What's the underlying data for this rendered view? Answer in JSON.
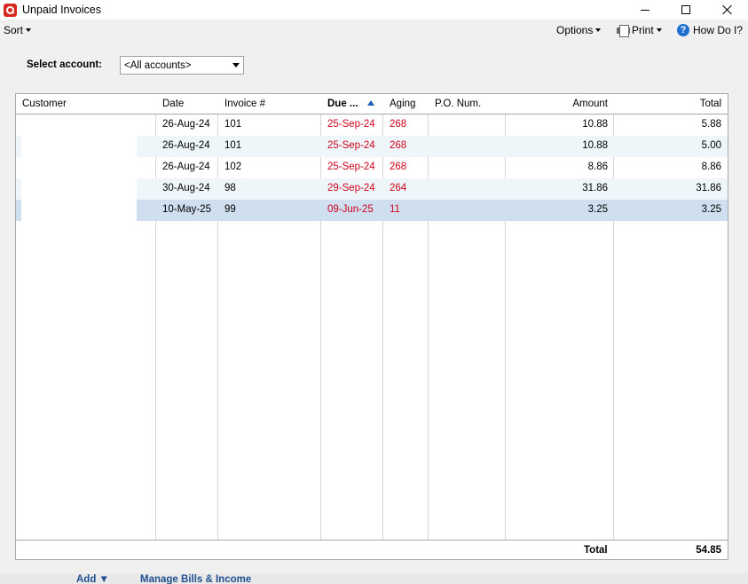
{
  "window": {
    "title": "Unpaid Invoices"
  },
  "menu": {
    "sort": "Sort",
    "options": "Options",
    "print": "Print",
    "how_do_i": "How Do I?"
  },
  "account": {
    "label": "Select account:",
    "selected": "<All accounts>"
  },
  "table": {
    "headers": {
      "customer": "Customer",
      "date": "Date",
      "invoice": "Invoice #",
      "due": "Due ...",
      "aging": "Aging",
      "po": "P.O. Num.",
      "amount": "Amount",
      "total": "Total"
    },
    "rows": [
      {
        "customer": "",
        "date": "26-Aug-24",
        "invoice": "101",
        "due": "25-Sep-24",
        "aging": "268",
        "po": "",
        "amount": "10.88",
        "total": "5.88"
      },
      {
        "customer": "",
        "date": "26-Aug-24",
        "invoice": "101",
        "due": "25-Sep-24",
        "aging": "268",
        "po": "",
        "amount": "10.88",
        "total": "5.00"
      },
      {
        "customer": "",
        "date": "26-Aug-24",
        "invoice": "102",
        "due": "25-Sep-24",
        "aging": "268",
        "po": "",
        "amount": "8.86",
        "total": "8.86"
      },
      {
        "customer": "",
        "date": "30-Aug-24",
        "invoice": "98",
        "due": "29-Sep-24",
        "aging": "264",
        "po": "",
        "amount": "31.86",
        "total": "31.86"
      },
      {
        "customer": "",
        "date": "10-May-25",
        "invoice": "99",
        "due": "09-Jun-25",
        "aging": "11",
        "po": "",
        "amount": "3.25",
        "total": "3.25"
      }
    ],
    "footer": {
      "label": "Total",
      "value": "54.85"
    }
  },
  "bottom_tabs": {
    "add": "Add ▼",
    "manage": "Manage Bills & Income"
  },
  "colors": {
    "overdue": "#d0021b",
    "selected_row": "#cfdff0",
    "alt_row": "#eef6fa",
    "brand": "#d52b1e"
  }
}
